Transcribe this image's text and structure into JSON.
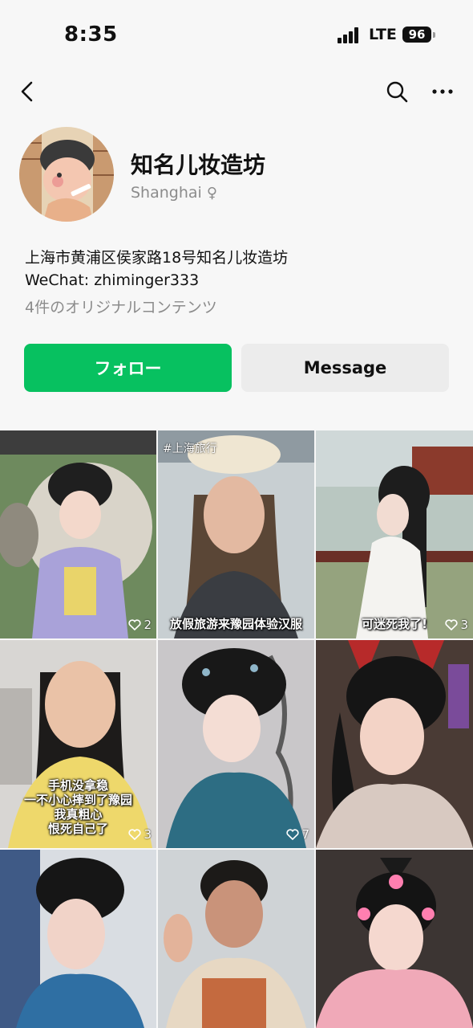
{
  "status_bar": {
    "time": "8:35",
    "network": "LTE",
    "battery": "96"
  },
  "nav": {
    "back_icon": "chevron-left-icon",
    "search_icon": "search-icon",
    "more_icon": "more-icon"
  },
  "profile": {
    "name": "知名儿妆造坊",
    "location": "Shanghai",
    "gender_symbol": "♀",
    "address": "上海市黄浦区侯家路18号知名儿妆造坊",
    "wechat": "WeChat: zhiminger333",
    "content_count": "4件のオリジナルコンテンツ"
  },
  "actions": {
    "follow_label": "フォロー",
    "message_label": "Message"
  },
  "colors": {
    "accent": "#07c160",
    "muted": "#8c8c8c"
  },
  "posts": [
    {
      "caption": "",
      "tag": "",
      "likes": "2"
    },
    {
      "caption": "放假旅游来豫园体验汉服",
      "tag": "#上海旅行",
      "likes": ""
    },
    {
      "caption": "可迷死我了!",
      "tag": "",
      "likes": "3"
    },
    {
      "caption_lines": [
        "手机没拿稳",
        "一不小心摔到了豫园",
        "我真粗心",
        "恨死自己了"
      ],
      "tag": "",
      "likes": "3"
    },
    {
      "caption": "",
      "tag": "",
      "likes": "7"
    },
    {
      "caption": "",
      "tag": "",
      "likes": ""
    },
    {
      "caption": "",
      "tag": "",
      "likes": ""
    },
    {
      "caption": "",
      "tag": "",
      "likes": ""
    },
    {
      "caption": "",
      "tag": "",
      "likes": ""
    }
  ]
}
